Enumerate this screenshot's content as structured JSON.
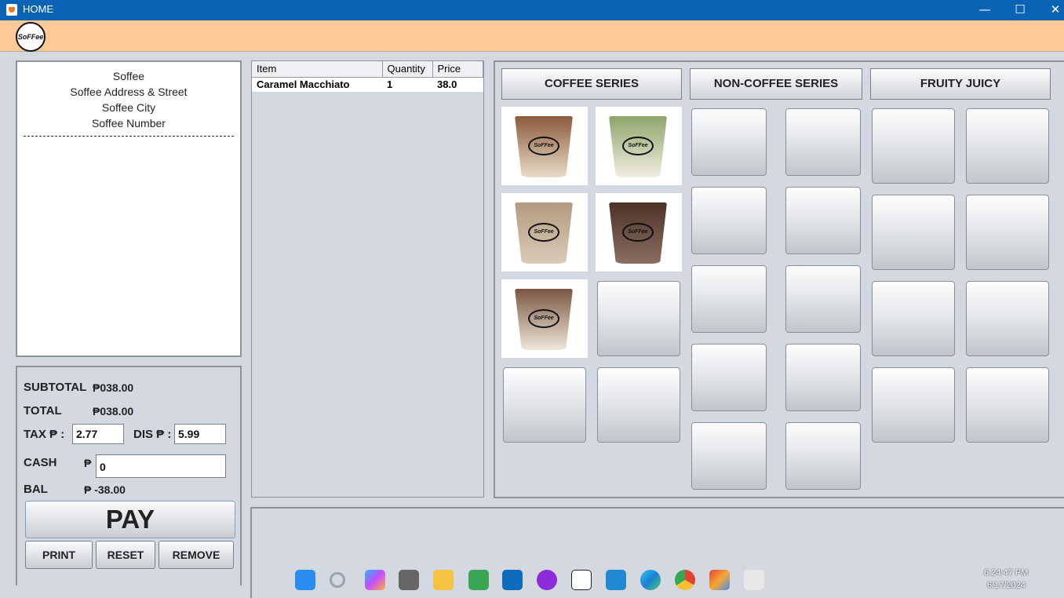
{
  "window": {
    "title": "HOME",
    "minimize": "—",
    "maximize": "☐",
    "close": "✕"
  },
  "header": {
    "logo_text": "SoFFee"
  },
  "receipt": {
    "lines": [
      "Soffee",
      "Soffee Address & Street",
      "Soffee City",
      "Soffee Number"
    ]
  },
  "totals": {
    "subtotal_label": "SUBTOTAL",
    "subtotal_value": "₱038.00",
    "total_label": "TOTAL",
    "total_value": "₱038.00",
    "tax_label": "TAX ₱ :",
    "tax_value": "2.77",
    "dis_label": "DIS ₱ :",
    "dis_value": "5.99",
    "cash_label": "CASH",
    "cash_currency": "₱",
    "cash_value": "0",
    "bal_label": "BAL",
    "bal_value": "₱ -38.00"
  },
  "actions": {
    "pay": "PAY",
    "print": "PRINT",
    "reset": "RESET",
    "remove": "REMOVE"
  },
  "order": {
    "columns": [
      "Item",
      "Quantity",
      "Price"
    ],
    "rows": [
      {
        "item": "Caramel Macchiato",
        "quantity": "1",
        "price": "38.0"
      }
    ]
  },
  "menu": {
    "tabs": [
      "COFFEE SERIES",
      "NON-COFFEE SERIES",
      "FRUITY JUICY"
    ],
    "coffee_items": [
      {
        "icon": "caramel-coffee-cup",
        "color_top": "#8b5a3c",
        "color_bottom": "#e9dcc8"
      },
      {
        "icon": "matcha-cup",
        "color_top": "#8ea56a",
        "color_bottom": "#f2ede2"
      },
      {
        "icon": "latte-cup",
        "color_top": "#b49a80",
        "color_bottom": "#d9cbb7"
      },
      {
        "icon": "mocha-cup",
        "color_top": "#4e3228",
        "color_bottom": "#8a6f62"
      },
      {
        "icon": "macchiato-cup",
        "color_top": "#7a5642",
        "color_bottom": "#efe7da"
      }
    ]
  },
  "taskbar": {
    "time": "6:24:47 PM",
    "date": "6/17/2024"
  }
}
